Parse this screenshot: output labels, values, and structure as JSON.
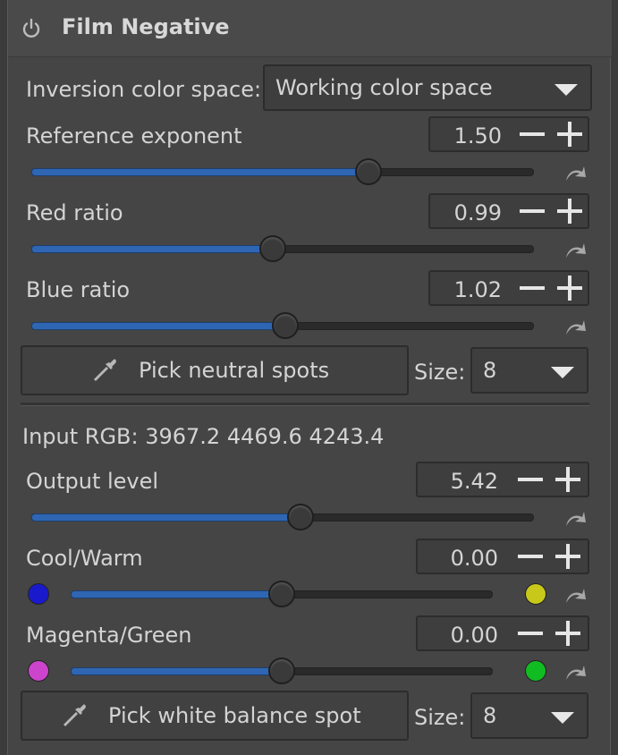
{
  "header": {
    "title": "Film Negative",
    "icon": "power-icon"
  },
  "inversion": {
    "label": "Inversion color space:",
    "value": "Working color space"
  },
  "reference_exponent": {
    "label": "Reference exponent",
    "value": "1.50",
    "level": 0.67
  },
  "red_ratio": {
    "label": "Red ratio",
    "value": "0.99",
    "level": 0.48
  },
  "blue_ratio": {
    "label": "Blue ratio",
    "value": "1.02",
    "level": 0.505
  },
  "pick_neutral": {
    "label": "Pick neutral spots",
    "size_label": "Size:",
    "size_value": "8"
  },
  "input_rgb": {
    "text": "Input RGB: 3967.2 4469.6 4243.4"
  },
  "output_level": {
    "label": "Output level",
    "value": "5.42",
    "level": 0.535
  },
  "cool_warm": {
    "label": "Cool/Warm",
    "value": "0.00",
    "level": 0.5,
    "left_color": "#1a1acc",
    "right_color": "#c8c81a"
  },
  "magenta_green": {
    "label": "Magenta/Green",
    "value": "0.00",
    "level": 0.5,
    "left_color": "#cc44cc",
    "right_color": "#11bb22"
  },
  "pick_wb": {
    "label": "Pick white balance spot",
    "size_label": "Size:",
    "size_value": "8"
  },
  "colors": {
    "accent": "#2f66b3",
    "panel": "#454545",
    "background": "#3b3b3b"
  }
}
